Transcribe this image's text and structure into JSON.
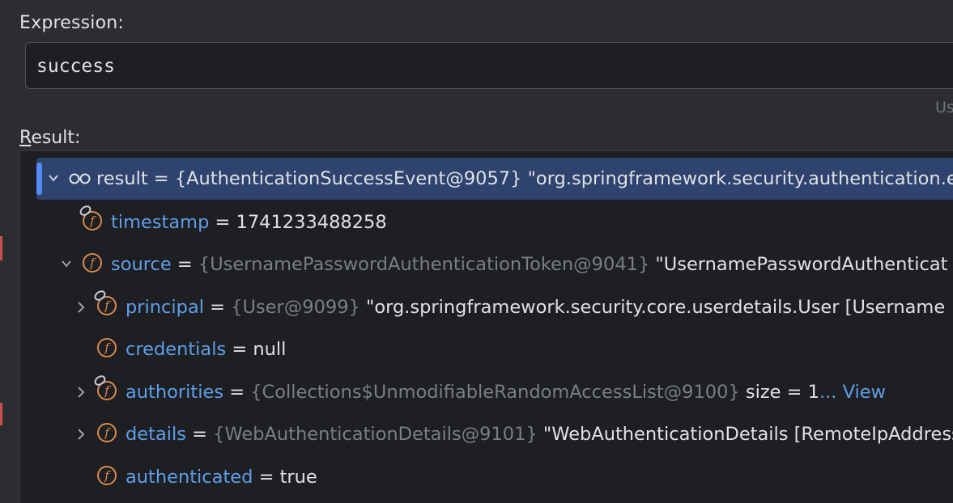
{
  "expression": {
    "label": "Expression:",
    "value": "success",
    "hint": "Us"
  },
  "result": {
    "label_mnemonic": "R",
    "label_rest": "esult:"
  },
  "tree": {
    "root": {
      "name": "result",
      "eq": " = ",
      "type": "{AuthenticationSuccessEvent@9057}",
      "value": " \"org.springframework.security.authentication.e"
    },
    "timestamp": {
      "name": "timestamp",
      "eq": " = ",
      "value": "1741233488258"
    },
    "source": {
      "name": "source",
      "eq": " = ",
      "type": "{UsernamePasswordAuthenticationToken@9041}",
      "value": " \"UsernamePasswordAuthenticat"
    },
    "principal": {
      "name": "principal",
      "eq": " = ",
      "type": "{User@9099}",
      "value": " \"org.springframework.security.core.userdetails.User [Username"
    },
    "credentials": {
      "name": "credentials",
      "eq": " = ",
      "value": "null"
    },
    "authorities": {
      "name": "authorities",
      "eq": " = ",
      "type": "{Collections$UnmodifiableRandomAccessList@9100}",
      "size": "  size = 1",
      "view": "... View"
    },
    "details": {
      "name": "details",
      "eq": " = ",
      "type": "{WebAuthenticationDetails@9101}",
      "value": " \"WebAuthenticationDetails [RemoteIpAddress"
    },
    "authenticated": {
      "name": "authenticated",
      "eq": " = ",
      "value": "true"
    }
  },
  "icons": {
    "field": "field-icon",
    "watch": "watch-icon",
    "chevron_down": "chevron-down-icon",
    "chevron_right": "chevron-right-icon"
  },
  "colors": {
    "background": "#2b2d30",
    "tree_background": "#1e1f22",
    "selection": "#2e436e",
    "field_name": "#5e9ee8",
    "field_icon": "#d98a4e",
    "type_gray": "#7a7e85"
  }
}
